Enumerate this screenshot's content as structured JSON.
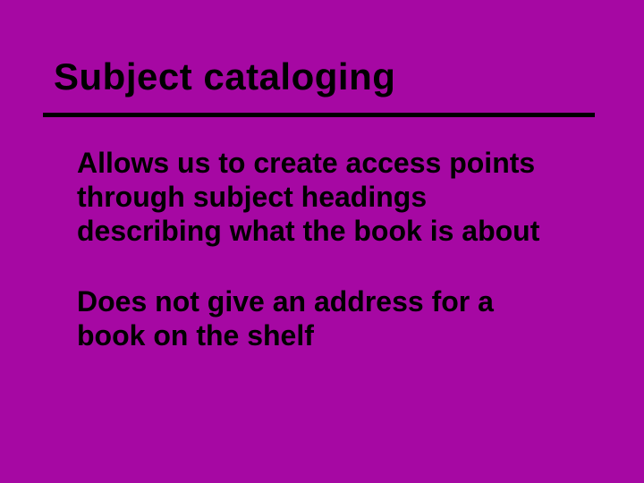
{
  "slide": {
    "title": "Subject cataloging",
    "paragraphs": [
      "Allows us to create access points through subject headings describing what the book is about",
      "Does not give an address for a book on the shelf"
    ]
  }
}
